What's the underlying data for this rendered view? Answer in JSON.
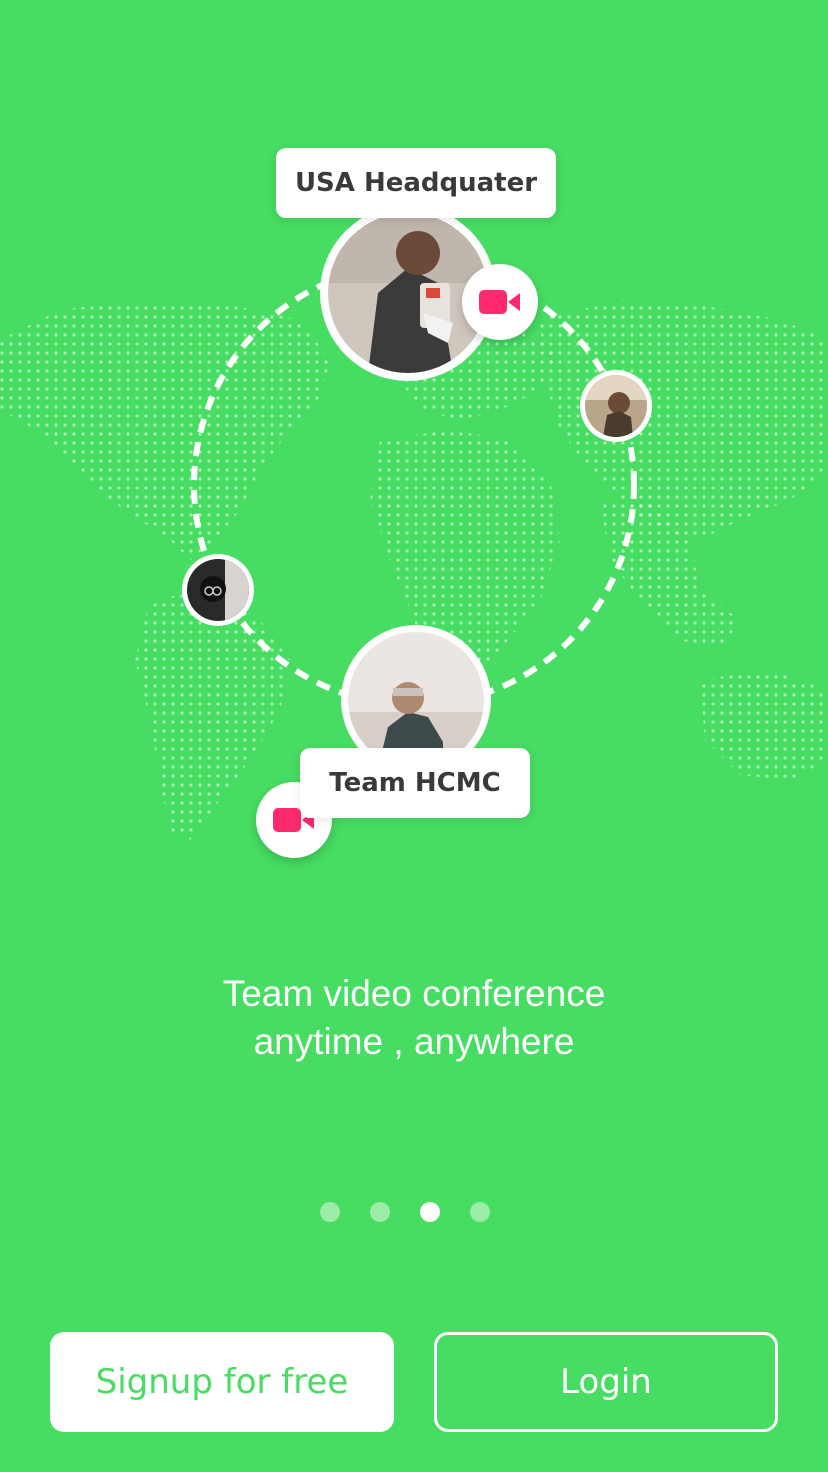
{
  "locations": {
    "usa_label": "USA Headquater",
    "hcmc_label": "Team HCMC"
  },
  "tagline": {
    "line1": "Team video conference",
    "line2": "anytime , anywhere"
  },
  "pager": {
    "total": 4,
    "active_index": 2
  },
  "buttons": {
    "signup_label": "Signup for free",
    "login_label": "Login"
  },
  "icons": {
    "video": "video-camera-icon"
  },
  "colors": {
    "background": "#47dc62",
    "accent": "#ff2a6d",
    "white": "#ffffff"
  }
}
